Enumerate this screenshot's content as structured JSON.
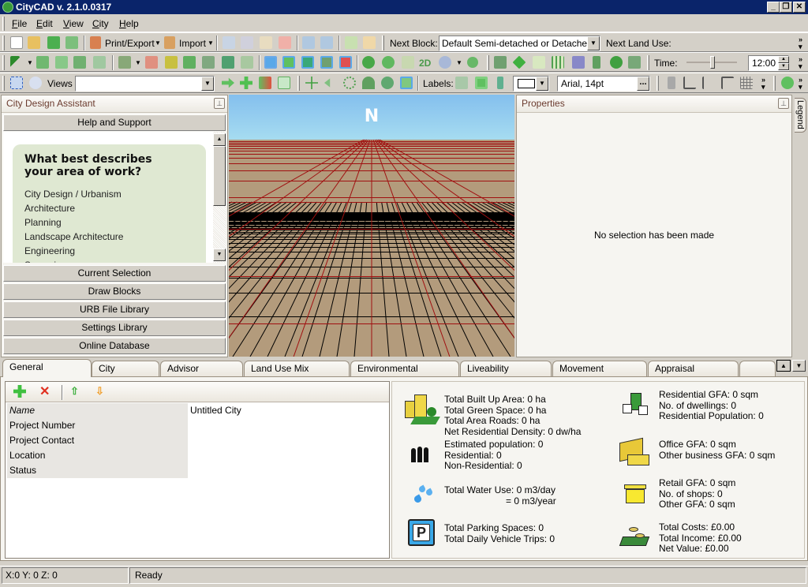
{
  "window": {
    "title": "CityCAD v. 2.1.0.0317",
    "controls": [
      "_",
      "❐",
      "✕"
    ]
  },
  "menu": [
    {
      "label": "File",
      "u": "F",
      "rest": "ile"
    },
    {
      "label": "Edit",
      "u": "E",
      "rest": "dit"
    },
    {
      "label": "View",
      "u": "V",
      "rest": "iew"
    },
    {
      "label": "City",
      "u": "C",
      "rest": "ity"
    },
    {
      "label": "Help",
      "u": "H",
      "rest": "elp"
    }
  ],
  "toolbar1": {
    "print_export": "Print/Export",
    "import": "Import",
    "next_block_label": "Next Block:",
    "next_block_value": "Default Semi-detached or Detache...",
    "next_land_use_label": "Next Land Use:"
  },
  "toolbar2": {
    "mode_2d": "2D",
    "time_label": "Time:",
    "time_value": "12:00",
    "time_slider_fraction": 0.5
  },
  "toolbar3": {
    "views_label": "Views",
    "views_value": "",
    "labels_label": "Labels:",
    "font_value": "Arial, 14pt",
    "ellipsis": "..."
  },
  "left_panel": {
    "title": "City Design Assistant",
    "help_section": "Help and Support",
    "question": "What best describes your area of work?",
    "options": [
      "City Design / Urbanism",
      "Architecture",
      "Planning",
      "Landscape Architecture",
      "Engineering",
      "Surveying"
    ],
    "sections": [
      "Current Selection",
      "Draw Blocks",
      "URB File Library",
      "Settings Library",
      "Online Database"
    ]
  },
  "viewport": {
    "north_label": "N",
    "sky_color": "#9fd3ef",
    "ground_color": "#b39b7c",
    "grid_major_color": "#a01010",
    "grid_minor_color": "#000000"
  },
  "properties": {
    "title": "Properties",
    "empty_message": "No selection has been made",
    "legend_tab": "Legend"
  },
  "bottom_tabs": [
    "General",
    "City",
    "Advisor",
    "Land Use Mix",
    "Environmental",
    "Liveability",
    "Movement",
    "Appraisal"
  ],
  "general": {
    "fields": [
      {
        "key": "Name",
        "value": "Untitled City"
      },
      {
        "key": "Project Number",
        "value": ""
      },
      {
        "key": "Project Contact",
        "value": ""
      },
      {
        "key": "Location",
        "value": ""
      },
      {
        "key": "Status",
        "value": ""
      }
    ]
  },
  "stats": {
    "area": [
      "Total Built Up Area: 0 ha",
      "Total Green Space: 0 ha",
      "Total Area Roads: 0 ha",
      "Net Residential Density: 0 dw/ha"
    ],
    "population": [
      "Estimated  population:  0",
      "Residential:  0",
      "Non-Residential: 0"
    ],
    "water": [
      "Total Water Use: 0 m3/day",
      "= 0 m3/year"
    ],
    "parking": [
      "Total  Parking  Spaces:  0",
      "Total Daily Vehicle Trips: 0"
    ],
    "residential": [
      "Residential  GFA:  0  sqm",
      "No.  of  dwellings:  0",
      "Residential Population: 0"
    ],
    "office": [
      "Office  GFA:  0  sqm",
      "Other business GFA: 0 sqm"
    ],
    "retail": [
      "Retail  GFA:  0  sqm",
      "No.  of  shops:  0",
      "Other GFA: 0 sqm"
    ],
    "finance": [
      "Total  Costs:  £0.00",
      "Total  Income:  £0.00",
      "Net Value: £0.00"
    ]
  },
  "statusbar": {
    "coords": "X:0 Y: 0 Z: 0",
    "status": "Ready"
  }
}
